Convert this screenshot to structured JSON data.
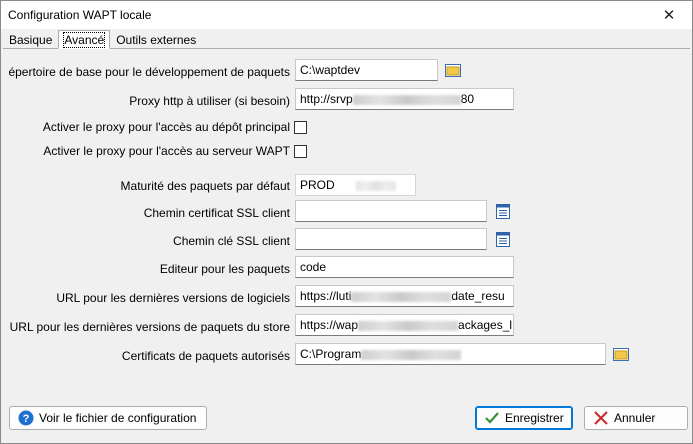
{
  "window": {
    "title": "Configuration WAPT locale",
    "close_glyph": "✕"
  },
  "tabs": [
    {
      "label": "Basique"
    },
    {
      "label": "Avancé"
    },
    {
      "label": "Outils externes"
    }
  ],
  "form": {
    "dev_base_dir": {
      "label": "épertoire de base pour le développement de paquets",
      "value": "C:\\waptdev"
    },
    "proxy": {
      "label": "Proxy http à utiliser (si besoin)",
      "value_prefix": "http://srvp",
      "value_suffix": "80"
    },
    "proxy_repo": {
      "label": "Activer le proxy pour l'accès au dépôt principal"
    },
    "proxy_server": {
      "label": "Activer le proxy pour l'accès au serveur WAPT"
    },
    "maturity": {
      "label": "Maturité des paquets par défaut",
      "value": "PROD"
    },
    "ssl_cert": {
      "label": "Chemin certificat SSL client",
      "value": ""
    },
    "ssl_key": {
      "label": "Chemin clé SSL client",
      "value": ""
    },
    "editor": {
      "label": "Editeur pour les paquets",
      "value": "code"
    },
    "url_soft": {
      "label": "URL pour les dernières versions de logiciels",
      "value_prefix": "https://luti",
      "value_suffix": "date_resu"
    },
    "url_store": {
      "label": "URL pour les dernières versions de paquets du store",
      "value_prefix": "https://wap",
      "value_suffix": "ackages_l"
    },
    "certs": {
      "label": "Certificats de paquets autorisés",
      "value_prefix": "C:\\Program"
    }
  },
  "buttons": {
    "view_config": "Voir le fichier de configuration",
    "save": "Enregistrer",
    "cancel": "Annuler"
  },
  "icons": {
    "help": "help-icon",
    "check": "check-icon",
    "cancel": "cancel-x-icon",
    "folder": "folder-icon",
    "document": "document-list-icon"
  },
  "colors": {
    "accent": "#0078d7",
    "check_green": "#3a8f3a",
    "cancel_red": "#c8282e",
    "folder_yellow": "#f2c84b"
  }
}
